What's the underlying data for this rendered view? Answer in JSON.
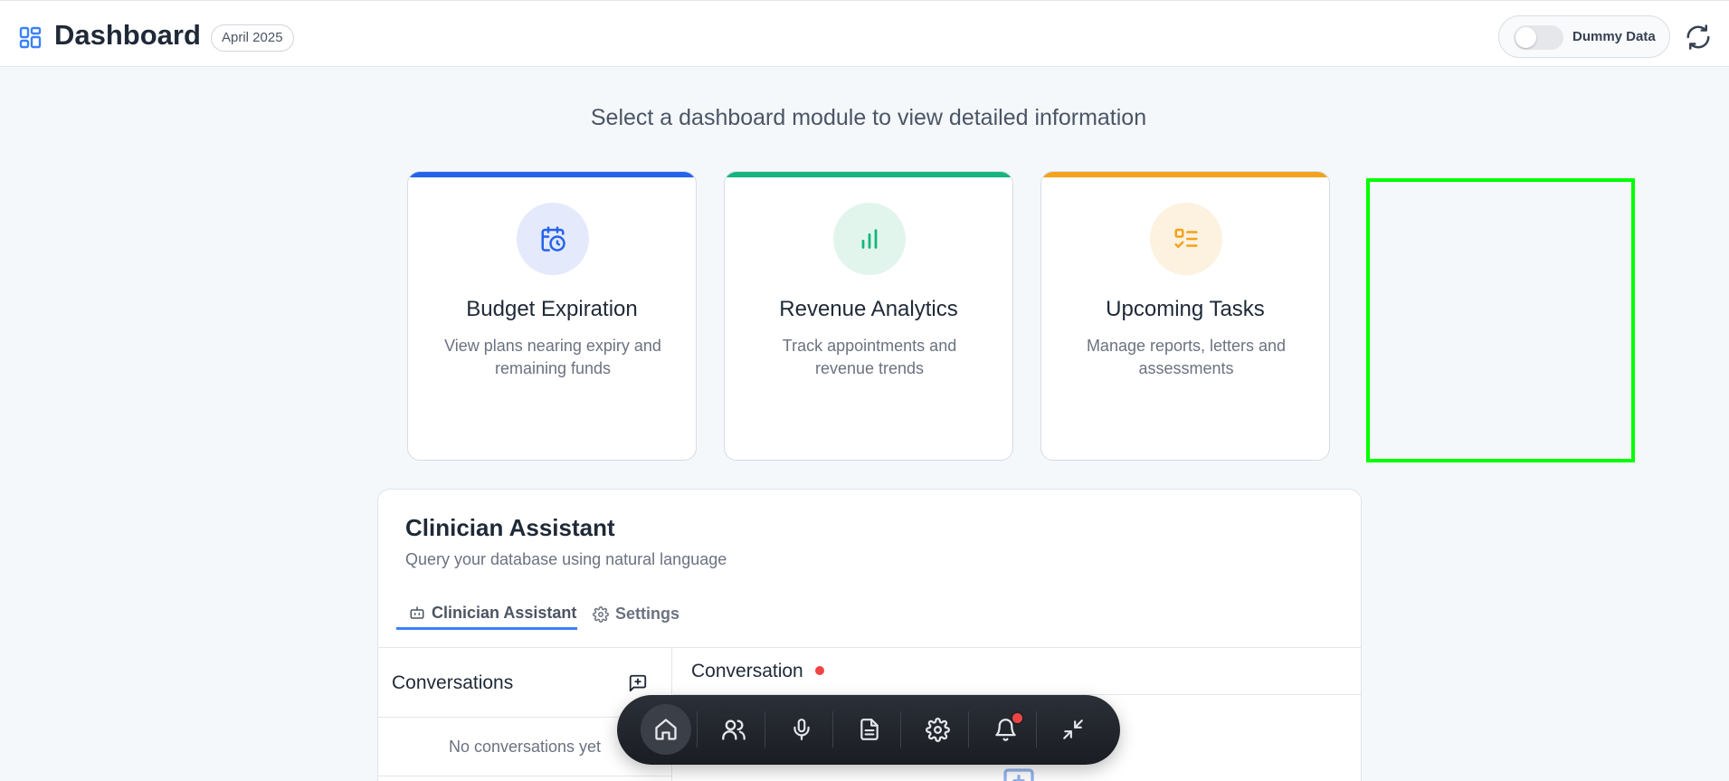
{
  "header": {
    "title": "Dashboard",
    "date_badge": "April 2025",
    "toggle_label": "Dummy Data",
    "toggle_on": false
  },
  "subtitle": "Select a dashboard module to view detailed information",
  "cards": [
    {
      "title": "Budget Expiration",
      "desc": "View plans nearing expiry and remaining funds",
      "accent": "#2563eb",
      "icon_bg": "#e4e9fb",
      "icon": "calendar-clock-icon"
    },
    {
      "title": "Revenue Analytics",
      "desc": "Track appointments and revenue trends",
      "accent": "#16b47e",
      "icon_bg": "#e2f5ec",
      "icon": "bar-chart-icon"
    },
    {
      "title": "Upcoming Tasks",
      "desc": "Manage reports, letters and assessments",
      "accent": "#f2a31b",
      "icon_bg": "#fdf1e0",
      "icon": "checklist-icon"
    }
  ],
  "assistant": {
    "title": "Clinician Assistant",
    "subtitle": "Query your database using natural language",
    "tabs": [
      {
        "label": "Clinician Assistant",
        "icon": "bot-icon"
      },
      {
        "label": "Settings",
        "icon": "gear-icon"
      }
    ],
    "conversations_title": "Conversations",
    "conversations_empty": "No conversations yet",
    "conversation_pane_title": "Conversation"
  },
  "dock": {
    "items": [
      "home-icon",
      "users-icon",
      "microphone-icon",
      "document-icon",
      "gear-icon",
      "bell-icon",
      "collapse-icon"
    ],
    "active": "home-icon",
    "has_notification": true
  },
  "colors": {
    "accent_blue": "#3b82f6",
    "highlight_green": "#00ff00",
    "status_red": "#ef4444"
  }
}
